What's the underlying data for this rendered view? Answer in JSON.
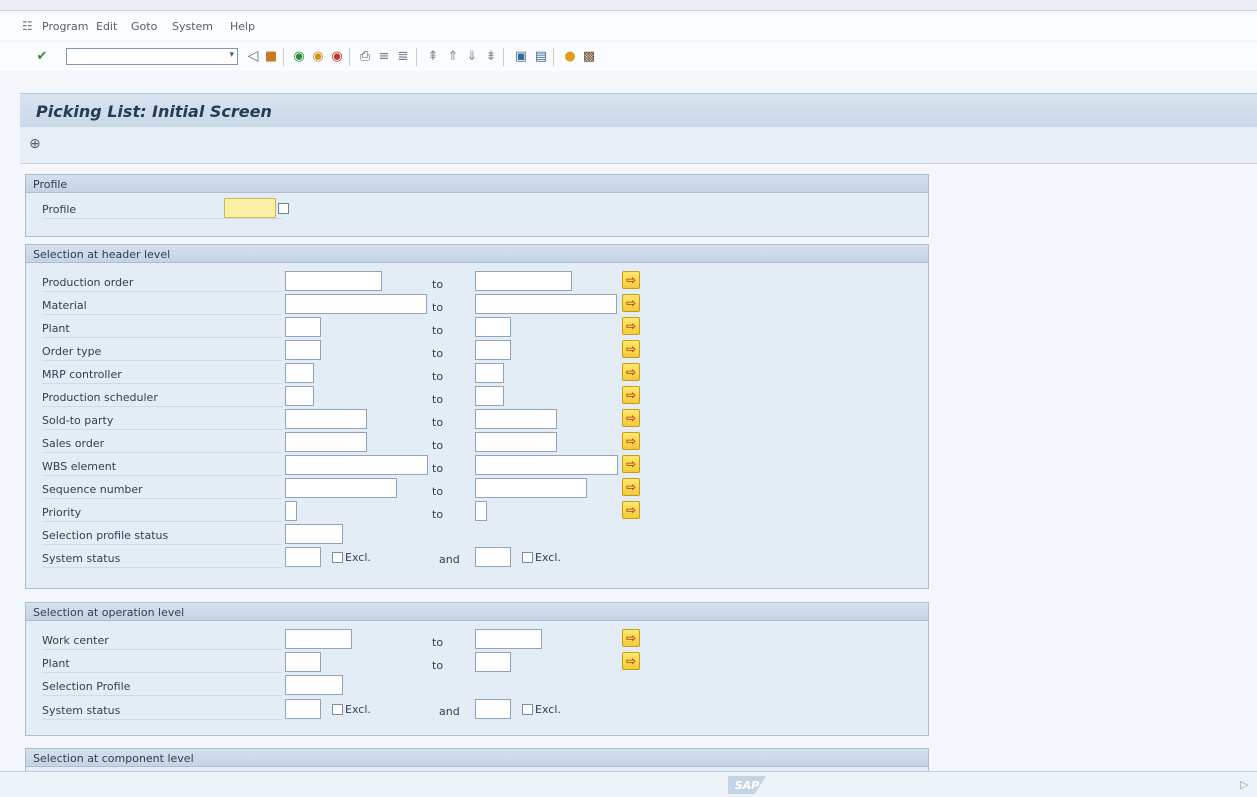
{
  "menu": {
    "items": [
      "Program",
      "Edit",
      "Goto",
      "System",
      "Help"
    ]
  },
  "toolbar": {
    "command_value": "",
    "buttons": [
      "enter-icon",
      "back-icon",
      "save-icon",
      "exit-icon",
      "cancel-icon",
      "stop-icon",
      "print-icon",
      "find-icon",
      "find-next-icon",
      "first-page-icon",
      "prev-page-icon",
      "next-page-icon",
      "last-page-icon",
      "create-session-icon",
      "shortcut-icon",
      "help-icon",
      "customize-icon"
    ]
  },
  "title": "Picking List: Initial Screen",
  "sections": {
    "profile": {
      "title": "Profile",
      "label": "Profile"
    },
    "header": {
      "title": "Selection at header level",
      "rows": [
        {
          "label": "Production order",
          "to": "to"
        },
        {
          "label": "Material",
          "to": "to"
        },
        {
          "label": "Plant",
          "to": "to"
        },
        {
          "label": "Order type",
          "to": "to"
        },
        {
          "label": "MRP controller",
          "to": "to"
        },
        {
          "label": "Production scheduler",
          "to": "to"
        },
        {
          "label": "Sold-to party",
          "to": "to"
        },
        {
          "label": "Sales order",
          "to": "to"
        },
        {
          "label": "WBS element",
          "to": "to"
        },
        {
          "label": "Sequence number",
          "to": "to"
        },
        {
          "label": "Priority",
          "to": "to"
        },
        {
          "label": "Selection profile status"
        },
        {
          "label": "System status",
          "excl1": "Excl.",
          "and": "and",
          "excl2": "Excl."
        }
      ]
    },
    "operation": {
      "title": "Selection at operation level",
      "rows": [
        {
          "label": "Work center",
          "to": "to"
        },
        {
          "label": "Plant",
          "to": "to"
        },
        {
          "label": "Selection Profile"
        },
        {
          "label": "System status",
          "excl1": "Excl.",
          "and": "and",
          "excl2": "Excl."
        }
      ]
    },
    "component": {
      "title": "Selection at component level"
    }
  },
  "status": {
    "logo": "SAP"
  },
  "colors": {
    "title_bar": "#c8d8e7",
    "section_bg": "#e4edf6",
    "required_field": "#fbf0a8",
    "multi_button": "#f4c93a"
  }
}
